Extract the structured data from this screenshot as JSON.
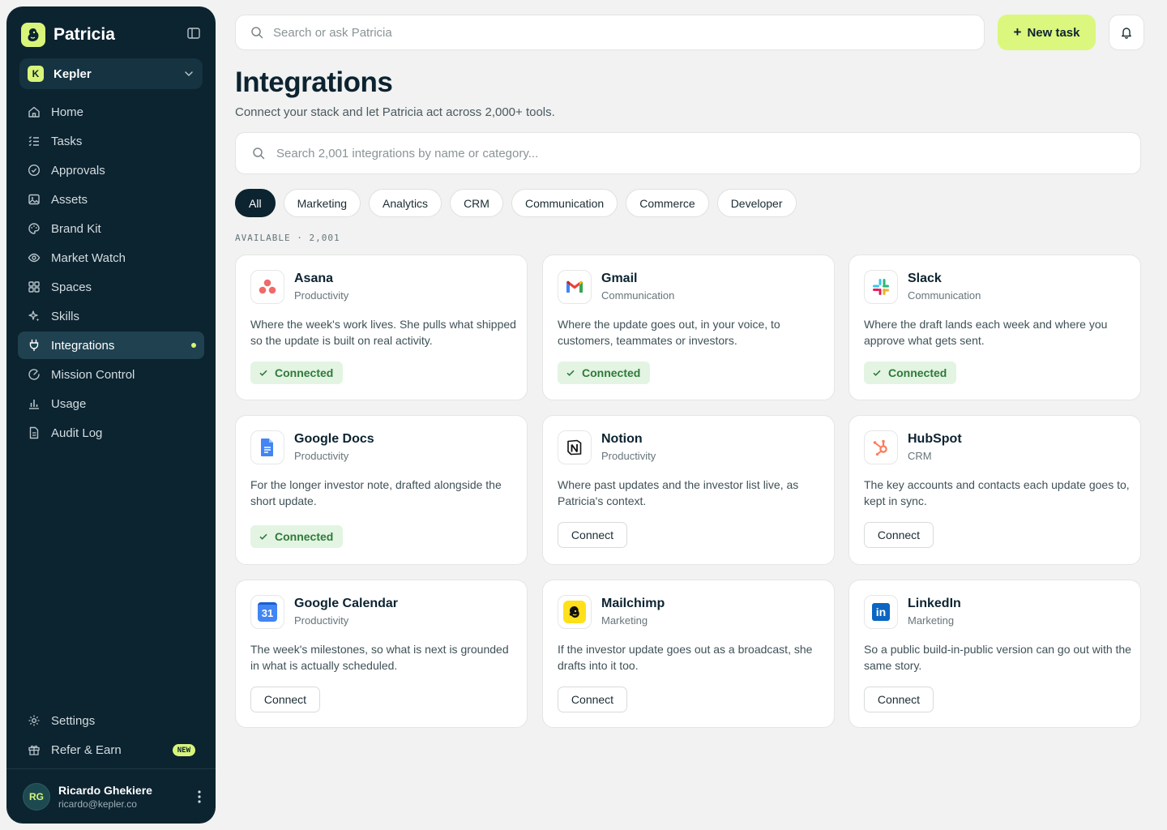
{
  "app": {
    "name": "Patricia"
  },
  "workspace": {
    "badge": "K",
    "name": "Kepler"
  },
  "nav": [
    {
      "label": "Home",
      "icon": "home-icon"
    },
    {
      "label": "Tasks",
      "icon": "tasks-icon"
    },
    {
      "label": "Approvals",
      "icon": "check-circle-icon"
    },
    {
      "label": "Assets",
      "icon": "image-icon"
    },
    {
      "label": "Brand Kit",
      "icon": "palette-icon"
    },
    {
      "label": "Market Watch",
      "icon": "eye-icon"
    },
    {
      "label": "Spaces",
      "icon": "grid-icon"
    },
    {
      "label": "Skills",
      "icon": "sparkle-icon"
    },
    {
      "label": "Integrations",
      "icon": "plug-icon",
      "active": true
    },
    {
      "label": "Mission Control",
      "icon": "gauge-icon"
    },
    {
      "label": "Usage",
      "icon": "bar-chart-icon"
    },
    {
      "label": "Audit Log",
      "icon": "document-icon"
    }
  ],
  "nav_bottom": [
    {
      "label": "Settings",
      "icon": "gear-icon"
    },
    {
      "label": "Refer & Earn",
      "icon": "gift-icon",
      "badge": "NEW"
    }
  ],
  "user": {
    "initials": "RG",
    "name": "Ricardo Ghekiere",
    "email": "ricardo@kepler.co"
  },
  "topbar": {
    "search_placeholder": "Search or ask Patricia",
    "new_task_label": "New task"
  },
  "page": {
    "title": "Integrations",
    "subtitle": "Connect your stack and let Patricia act across 2,000+ tools.",
    "search_placeholder": "Search 2,001 integrations by name or category...",
    "filters": [
      "All",
      "Marketing",
      "Analytics",
      "CRM",
      "Communication",
      "Commerce",
      "Developer"
    ],
    "active_filter": "All",
    "section_label": "AVAILABLE · 2,001"
  },
  "integrations": [
    {
      "name": "Asana",
      "category": "Productivity",
      "description": "Where the week's work lives. She pulls what shipped so the update is built on real activity.",
      "status": "Connected",
      "logo": "asana-icon"
    },
    {
      "name": "Gmail",
      "category": "Communication",
      "description": "Where the update goes out, in your voice, to customers, teammates or investors.",
      "status": "Connected",
      "logo": "gmail-icon"
    },
    {
      "name": "Slack",
      "category": "Communication",
      "description": "Where the draft lands each week and where you approve what gets sent.",
      "status": "Connected",
      "logo": "slack-icon"
    },
    {
      "name": "Google Docs",
      "category": "Productivity",
      "description": "For the longer investor note, drafted alongside the short update.",
      "status": "Connected",
      "logo": "google-docs-icon"
    },
    {
      "name": "Notion",
      "category": "Productivity",
      "description": "Where past updates and the investor list live, as Patricia's context.",
      "status": "Connect",
      "logo": "notion-icon"
    },
    {
      "name": "HubSpot",
      "category": "CRM",
      "description": "The key accounts and contacts each update goes to, kept in sync.",
      "status": "Connect",
      "logo": "hubspot-icon"
    },
    {
      "name": "Google Calendar",
      "category": "Productivity",
      "description": "The week's milestones, so what is next is grounded in what is actually scheduled.",
      "status": "Connect",
      "logo": "google-calendar-icon",
      "logo_text": "31"
    },
    {
      "name": "Mailchimp",
      "category": "Marketing",
      "description": "If the investor update goes out as a broadcast, she drafts into it too.",
      "status": "Connect",
      "logo": "mailchimp-icon"
    },
    {
      "name": "LinkedIn",
      "category": "Marketing",
      "description": "So a public build-in-public version can go out with the same story.",
      "status": "Connect",
      "logo": "linkedin-icon",
      "logo_text": "in"
    }
  ],
  "colors": {
    "sidebar": "#0c2330",
    "accent": "#d8f57a",
    "connected_bg": "#e3f4e3",
    "connected_text": "#2f7a38"
  }
}
